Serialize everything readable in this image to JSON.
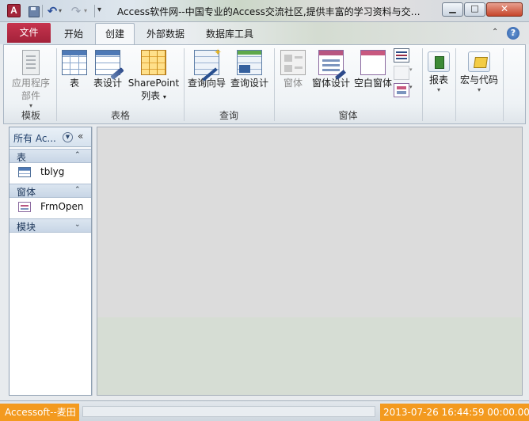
{
  "window": {
    "app_icon_letter": "A",
    "title": "Access软件网--中国专业的Access交流社区,提供丰富的学习资料与交流..."
  },
  "qat": {
    "undo": "↶",
    "redo": "↷",
    "caret": "▾",
    "customize": "▾"
  },
  "window_buttons": {
    "minimize": "▁",
    "maximize": "□",
    "close": "✕"
  },
  "tabs": {
    "file": "文件",
    "home": "开始",
    "create": "创建",
    "external": "外部数据",
    "dbtools": "数据库工具",
    "help_caret": "⌃",
    "help": "?",
    "active": "创建"
  },
  "ribbon": {
    "groups": {
      "templates": "模板",
      "tables": "表格",
      "queries": "查询",
      "forms": "窗体"
    },
    "buttons": {
      "app_parts_line1": "应用程序",
      "app_parts_line2": "部件",
      "table": "表",
      "table_design": "表设计",
      "sharepoint_line1": "SharePoint",
      "sharepoint_line2": "列表",
      "query_wizard": "查询向导",
      "query_design": "查询设计",
      "form": "窗体",
      "form_design": "窗体设计",
      "blank_form": "空白窗体",
      "report": "报表",
      "macro_code": "宏与代码",
      "dropdown": "▾"
    }
  },
  "nav": {
    "header": "所有 Ac...",
    "header_dd": "▼",
    "header_collapse": "«",
    "sections": [
      {
        "label": "表",
        "chevron": "⌃",
        "items": [
          {
            "label": "tblyg"
          }
        ]
      },
      {
        "label": "窗体",
        "chevron": "⌃",
        "items": [
          {
            "label": "FrmOpen"
          }
        ]
      },
      {
        "label": "模块",
        "chevron": "⌄",
        "items": []
      }
    ]
  },
  "status": {
    "left": "Accessoft--麦田",
    "right": "2013-07-26 16:44:59 00:00.000"
  },
  "colors": {
    "file_tab": "#a3223a",
    "status_accent": "#f39a1f",
    "nav_header": "#d6e2ee"
  }
}
